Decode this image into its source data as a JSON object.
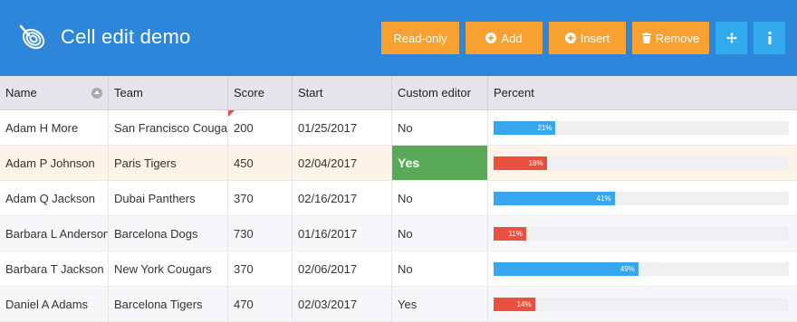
{
  "app": {
    "title": "Cell edit demo"
  },
  "toolbar": {
    "readonly_label": "Read-only",
    "add_label": "Add",
    "insert_label": "Insert",
    "remove_label": "Remove",
    "move_icon": "move-arrows-icon",
    "info_icon": "info-icon"
  },
  "colors": {
    "header_bg": "#2d86d9",
    "button_orange": "#f6a130",
    "button_blue": "#33a9ee",
    "bar_blue": "#36a6ee",
    "bar_red": "#e8513e",
    "yes_green": "#5aa957"
  },
  "grid": {
    "columns": [
      "Name",
      "Team",
      "Score",
      "Start",
      "Custom editor",
      "Percent"
    ],
    "rows": [
      {
        "name": "Adam H More",
        "team": "San Francisco Cougars",
        "score": "200",
        "start": "01/25/2017",
        "custom": "No",
        "percent": 21,
        "percent_label": "21%",
        "bar_color": "#36a6ee"
      },
      {
        "name": "Adam P Johnson",
        "team": "Paris Tigers",
        "score": "450",
        "start": "02/04/2017",
        "custom": "Yes",
        "percent": 18,
        "percent_label": "18%",
        "bar_color": "#e8513e"
      },
      {
        "name": "Adam Q Jackson",
        "team": "Dubai Panthers",
        "score": "370",
        "start": "02/16/2017",
        "custom": "No",
        "percent": 41,
        "percent_label": "41%",
        "bar_color": "#36a6ee"
      },
      {
        "name": "Barbara L Anderson",
        "team": "Barcelona Dogs",
        "score": "730",
        "start": "01/16/2017",
        "custom": "No",
        "percent": 11,
        "percent_label": "11%",
        "bar_color": "#e8513e"
      },
      {
        "name": "Barbara T Jackson",
        "team": "New York Cougars",
        "score": "370",
        "start": "02/06/2017",
        "custom": "No",
        "percent": 49,
        "percent_label": "49%",
        "bar_color": "#36a6ee"
      },
      {
        "name": "Daniel A Adams",
        "team": "Barcelona Tigers",
        "score": "470",
        "start": "02/03/2017",
        "custom": "Yes",
        "percent": 14,
        "percent_label": "14%",
        "bar_color": "#e8513e"
      }
    ]
  }
}
